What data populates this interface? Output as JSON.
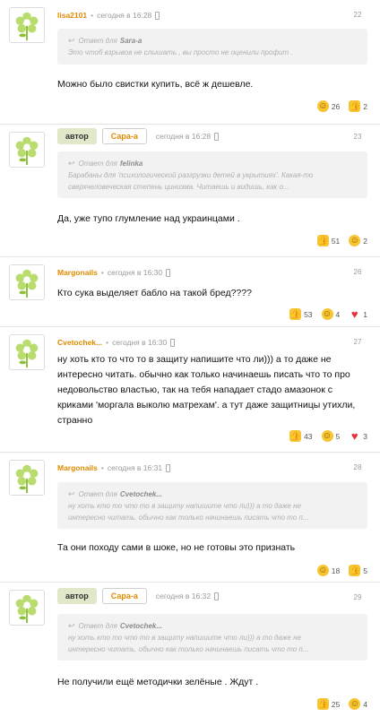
{
  "comments": [
    {
      "author": "lisa2101",
      "time": "сегодня в 16:28",
      "number": "22",
      "reply_label": "Ответ для",
      "reply_to": "Sara-a",
      "quote": "Это чтоб взрывов не слышать , вы просто не оценили профит .",
      "text": "Можно было свистки купить, всё ж дешевле.",
      "laugh": "26",
      "like": "2"
    },
    {
      "badge": "автор",
      "author": "Сара-а",
      "time": "сегодня в 16:28",
      "number": "23",
      "reply_label": "Ответ для",
      "reply_to": "felinka",
      "quote": "Барабаны для 'психологической разгрузки детей в укрытиях'. Какая-то сверхчеловеческая степень цинизма. Читаешь и видишь, как о...",
      "text": "Да, уже тупо глумление над украинцами .",
      "like": "51",
      "laugh": "2"
    },
    {
      "author": "Margonails",
      "time": "сегодня в 16:30",
      "number": "26",
      "text": "Кто сука выделяет бабло на такой бред????",
      "like": "53",
      "laugh": "4",
      "heart": "1"
    },
    {
      "author": "Cvetochek...",
      "time": "сегодня в 16:30",
      "number": "27",
      "text": "ну хоть кто то что то в защиту напишите что ли))) а то даже не интересно читать. обычно как только начинаешь писать что то про недовольство властью, так на тебя нападает стадо амазонок с криками 'моргала выколю матрехам'. а тут даже защитницы утихли, странно",
      "like": "43",
      "laugh": "5",
      "heart": "3"
    },
    {
      "author": "Margonails",
      "time": "сегодня в 16:31",
      "number": "28",
      "reply_label": "Ответ для",
      "reply_to": "Cvetochek...",
      "quote_line1": "ну хоть кто то что то в защиту напишите что ли))) а то даже не",
      "quote_line2": "интересно читать. обычно как только начинаешь писать что то п...",
      "text": "Та они походу сами в шоке, но не готовы это признать",
      "laugh": "18",
      "like": "5"
    },
    {
      "badge": "автор",
      "author": "Сара-а",
      "time": "сегодня в 16:32",
      "number": "29",
      "reply_label": "Ответ для",
      "reply_to": "Cvetochek...",
      "quote_line1": "ну хоть кто то что то в защиту напишите что ли))) а то даже не",
      "quote_line2": "интересно читать. обычно как только начинаешь писать что то п...",
      "text": "Не получили ещё методички зелёные . Ждут .",
      "like": "25",
      "laugh": "4"
    }
  ],
  "icons": {
    "avatar": "flower-avatar-icon",
    "reply": "reply-arrow-icon",
    "device": "phone-icon",
    "like": "thumbs-up-icon",
    "laugh": "laughing-face-icon",
    "heart": "heart-icon"
  },
  "colors": {
    "author": "#e08a00",
    "badge_bg": "#dfe9c9",
    "quote_bg": "#f2f2f2",
    "heart": "#e5333a"
  }
}
